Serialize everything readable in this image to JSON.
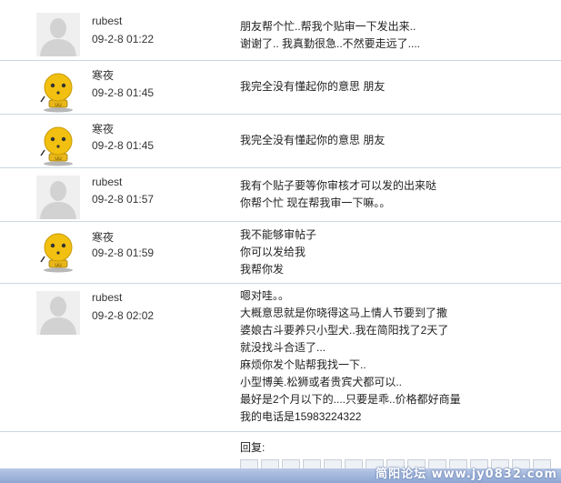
{
  "posts": [
    {
      "user": "rubest",
      "time": "09-2-8 01:22",
      "avatar": "default-silhouette",
      "lines": [
        "朋友帮个忙..帮我个贴审一下发出来..",
        "谢谢了.. 我真勤很急..不然要走远了...."
      ]
    },
    {
      "user": "寒夜",
      "time": "09-2-8 01:45",
      "avatar": "yellow-mascot",
      "lines": [
        "我完全没有懂起你的意思  朋友"
      ]
    },
    {
      "user": "寒夜",
      "time": "09-2-8 01:45",
      "avatar": "yellow-mascot",
      "lines": [
        "我完全没有懂起你的意思  朋友"
      ]
    },
    {
      "user": "rubest",
      "time": "09-2-8 01:57",
      "avatar": "default-silhouette",
      "lines": [
        "我有个贴子要等你审核才可以发的出来哒",
        "你帮个忙  现在帮我审一下嘛。。"
      ]
    },
    {
      "user": "寒夜",
      "time": "09-2-8 01:59",
      "avatar": "yellow-mascot",
      "lines": [
        "我不能够审帖子",
        "你可以发给我",
        "我帮你发"
      ]
    },
    {
      "user": "rubest",
      "time": "09-2-8 02:02",
      "avatar": "default-silhouette",
      "lines": [
        "嗯对哇。。",
        "大概意思就是你晓得这马上情人节要到了撒",
        "婆娘古斗要养只小型犬..我在简阳找了2天了",
        "就没找斗合适了...",
        "麻烦你发个贴帮我找一下..",
        "小型博美.松狮或者贵宾犬都可以..",
        "最好是2个月以下的....只要是乖..价格都好商量",
        "我的电话是15983224322"
      ]
    }
  ],
  "reply": {
    "label": "回复:"
  },
  "watermark": "简阳论坛 www.jy0832.com",
  "colors": {
    "separator": "#c9d8df",
    "mascot": "#f2c010",
    "bottom_bar": "#a3b8de"
  }
}
